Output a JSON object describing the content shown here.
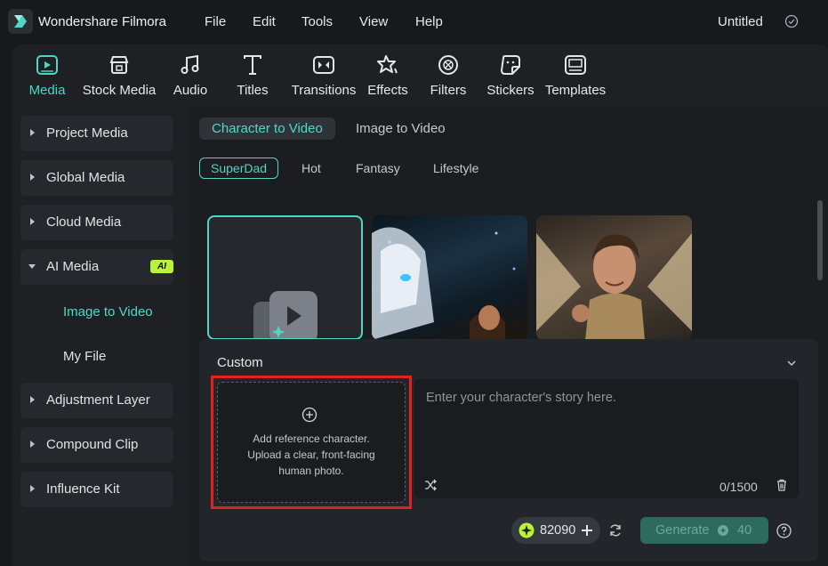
{
  "titlebar": {
    "app_name": "Wondershare Filmora",
    "menus": [
      "File",
      "Edit",
      "Tools",
      "View",
      "Help"
    ],
    "doc_title": "Untitled"
  },
  "toolbar": {
    "items": [
      {
        "label": "Media",
        "icon": "media-icon",
        "active": true
      },
      {
        "label": "Stock Media",
        "icon": "stock-media-icon"
      },
      {
        "label": "Audio",
        "icon": "audio-icon"
      },
      {
        "label": "Titles",
        "icon": "titles-icon"
      },
      {
        "label": "Transitions",
        "icon": "transitions-icon"
      },
      {
        "label": "Effects",
        "icon": "effects-icon"
      },
      {
        "label": "Filters",
        "icon": "filters-icon"
      },
      {
        "label": "Stickers",
        "icon": "stickers-icon"
      },
      {
        "label": "Templates",
        "icon": "templates-icon"
      }
    ]
  },
  "sidebar": {
    "items": [
      {
        "label": "Project Media"
      },
      {
        "label": "Global Media"
      },
      {
        "label": "Cloud Media"
      },
      {
        "label": "AI Media",
        "badge": "AI",
        "expanded": true
      },
      {
        "label": "Adjustment Layer"
      },
      {
        "label": "Compound Clip"
      },
      {
        "label": "Influence Kit"
      }
    ],
    "sub_items": [
      {
        "label": "Image to Video",
        "active": true
      },
      {
        "label": "My File"
      }
    ]
  },
  "main": {
    "mode_tabs": [
      "Character to Video",
      "Image to Video"
    ],
    "categories": [
      "SuperDad",
      "Hot",
      "Fantasy",
      "Lifestyle"
    ],
    "custom": {
      "title": "Custom",
      "upload_line1": "Add reference character.",
      "upload_line2": "Upload a clear, front-facing",
      "upload_line3": "human photo.",
      "story_placeholder": "Enter your character's story here.",
      "char_count": "0/1500"
    },
    "credits": "82090",
    "generate_label": "Generate",
    "generate_cost": "40"
  },
  "colors": {
    "accent": "#4fd6c4",
    "highlight_border": "#e0231f",
    "ai_badge": "#b8f23a"
  }
}
